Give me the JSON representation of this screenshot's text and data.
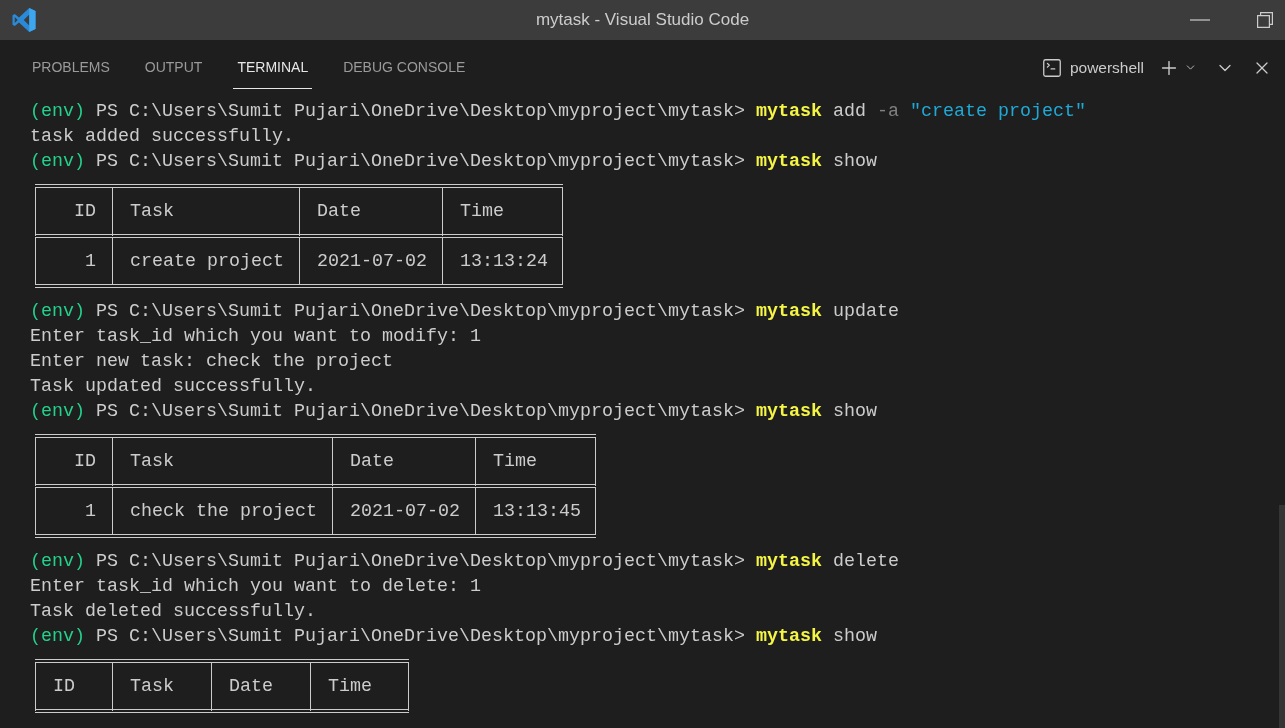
{
  "window": {
    "title": "mytask - Visual Studio Code"
  },
  "panel": {
    "tabs": [
      {
        "label": "PROBLEMS",
        "selected": false
      },
      {
        "label": "OUTPUT",
        "selected": false
      },
      {
        "label": "TERMINAL",
        "selected": true
      },
      {
        "label": "DEBUG CONSOLE",
        "selected": false
      }
    ],
    "terminal_selector": {
      "label": "powershell"
    }
  },
  "terminal": {
    "lines": [
      {
        "kind": "prompt",
        "env": "(env)",
        "path": "PS C:\\Users\\Sumit Pujari\\OneDrive\\Desktop\\myproject\\mytask>",
        "command": "mytask",
        "args": [
          {
            "kind": "word",
            "text": "add"
          },
          {
            "kind": "flag",
            "text": "-a"
          },
          {
            "kind": "string",
            "text": "\"create project\""
          }
        ]
      },
      {
        "kind": "output",
        "text": "task added successfully."
      },
      {
        "kind": "prompt",
        "env": "(env)",
        "path": "PS C:\\Users\\Sumit Pujari\\OneDrive\\Desktop\\myproject\\mytask>",
        "command": "mytask",
        "args": [
          {
            "kind": "word",
            "text": "show"
          }
        ]
      },
      {
        "kind": "table",
        "columns": [
          {
            "label": "ID",
            "right_aligned": true
          },
          {
            "label": "Task",
            "right_aligned": false
          },
          {
            "label": "Date",
            "right_aligned": false
          },
          {
            "label": "Time",
            "right_aligned": false
          }
        ],
        "rows": [
          [
            "1",
            "create project",
            "2021-07-02",
            "13:13:24"
          ]
        ]
      },
      {
        "kind": "prompt",
        "env": "(env)",
        "path": "PS C:\\Users\\Sumit Pujari\\OneDrive\\Desktop\\myproject\\mytask>",
        "command": "mytask",
        "args": [
          {
            "kind": "word",
            "text": "update"
          }
        ]
      },
      {
        "kind": "output",
        "text": "Enter task_id which you want to modify: 1"
      },
      {
        "kind": "output",
        "text": "Enter new task: check the project"
      },
      {
        "kind": "output",
        "text": "Task updated successfully."
      },
      {
        "kind": "prompt",
        "env": "(env)",
        "path": "PS C:\\Users\\Sumit Pujari\\OneDrive\\Desktop\\myproject\\mytask>",
        "command": "mytask",
        "args": [
          {
            "kind": "word",
            "text": "show"
          }
        ]
      },
      {
        "kind": "table",
        "columns": [
          {
            "label": "ID",
            "right_aligned": true
          },
          {
            "label": "Task",
            "right_aligned": false
          },
          {
            "label": "Date",
            "right_aligned": false
          },
          {
            "label": "Time",
            "right_aligned": false
          }
        ],
        "rows": [
          [
            "1",
            "check the project",
            "2021-07-02",
            "13:13:45"
          ]
        ]
      },
      {
        "kind": "prompt",
        "env": "(env)",
        "path": "PS C:\\Users\\Sumit Pujari\\OneDrive\\Desktop\\myproject\\mytask>",
        "command": "mytask",
        "args": [
          {
            "kind": "word",
            "text": "delete"
          }
        ]
      },
      {
        "kind": "output",
        "text": "Enter task_id which you want to delete: 1"
      },
      {
        "kind": "output",
        "text": "Task deleted successfully."
      },
      {
        "kind": "prompt",
        "env": "(env)",
        "path": "PS C:\\Users\\Sumit Pujari\\OneDrive\\Desktop\\myproject\\mytask>",
        "command": "mytask",
        "args": [
          {
            "kind": "word",
            "text": "show"
          }
        ]
      },
      {
        "kind": "table",
        "columns": [
          {
            "label": "ID",
            "right_aligned": false
          },
          {
            "label": "Task",
            "right_aligned": false
          },
          {
            "label": "Date",
            "right_aligned": false
          },
          {
            "label": "Time",
            "right_aligned": false
          }
        ]
      }
    ]
  }
}
